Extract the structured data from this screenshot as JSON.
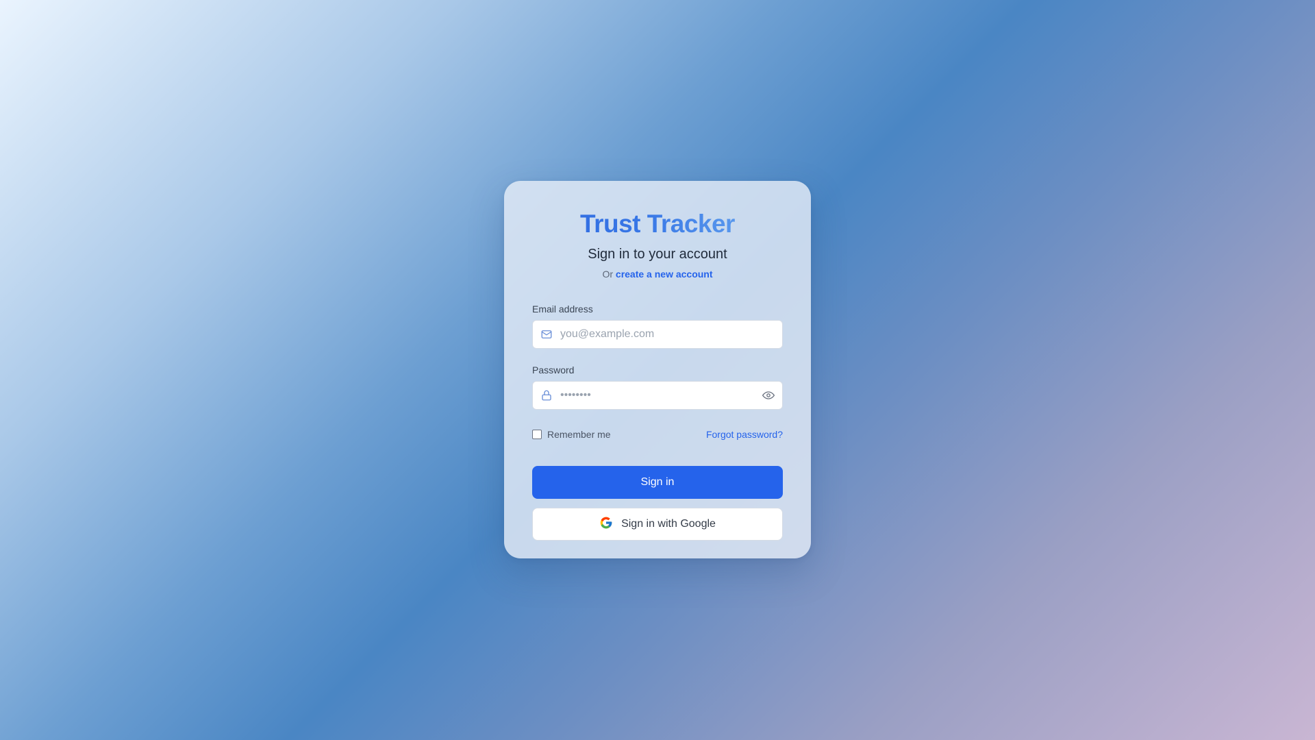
{
  "app": {
    "title": "Trust Tracker",
    "subtitle": "Sign in to your account",
    "alt_prefix": "Or",
    "alt_link": "create a new account"
  },
  "form": {
    "email": {
      "label": "Email address",
      "value": "",
      "placeholder": "you@example.com",
      "icon": "mail-icon"
    },
    "password": {
      "label": "Password",
      "value": "",
      "placeholder": "••••••••",
      "icon": "lock-icon",
      "toggle_icon": "eye-icon"
    },
    "remember_label": "Remember me",
    "remember_checked": false,
    "forgot_label": "Forgot password?",
    "submit_label": "Sign in",
    "google_label": "Sign in with Google"
  },
  "colors": {
    "accent": "#2563eb",
    "card_bg": "#e4ecf7",
    "title_start": "#2f6ae0",
    "title_end": "#69a8f0"
  }
}
